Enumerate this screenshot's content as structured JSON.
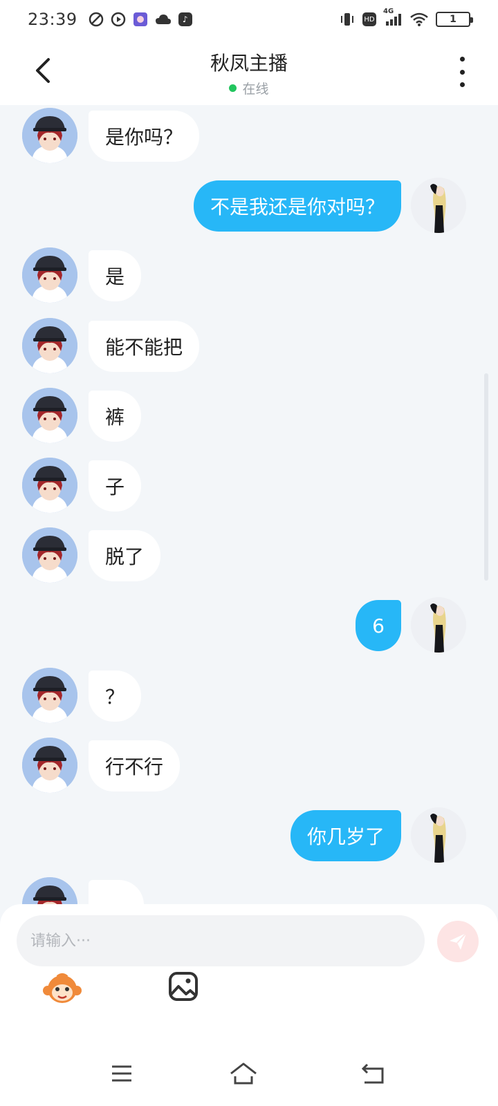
{
  "status_bar": {
    "time": "23:39",
    "network": "4G",
    "hd": "HD",
    "battery": "1"
  },
  "header": {
    "title": "秋凤主播",
    "status": "在线"
  },
  "messages": [
    {
      "side": "left",
      "text": "是你吗？"
    },
    {
      "side": "right",
      "text": "不是我还是你对吗？"
    },
    {
      "side": "left",
      "text": "是"
    },
    {
      "side": "left",
      "text": "能不能把"
    },
    {
      "side": "left",
      "text": "裤"
    },
    {
      "side": "left",
      "text": "子"
    },
    {
      "side": "left",
      "text": "脱了"
    },
    {
      "side": "right",
      "text": "6"
    },
    {
      "side": "left",
      "text": "？"
    },
    {
      "side": "left",
      "text": "行不行"
    },
    {
      "side": "right",
      "text": "你几岁了"
    },
    {
      "side": "left",
      "text": ""
    }
  ],
  "input": {
    "placeholder": "请输入···"
  },
  "colors": {
    "accent": "#27b7f7",
    "background": "#f3f6f9",
    "online": "#22c55e",
    "send_button": "#fde4e4"
  },
  "icons": {
    "emoji_tool": "monkey-emoji-icon",
    "image_tool": "image-icon",
    "send": "send-icon"
  }
}
